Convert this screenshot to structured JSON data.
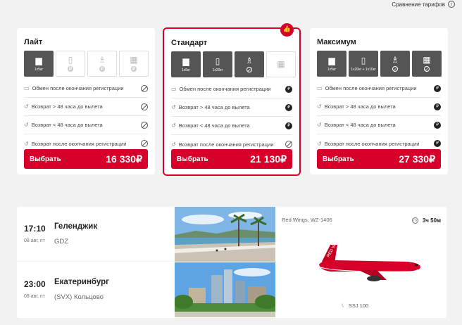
{
  "compare": {
    "label": "Сравнение тарифов"
  },
  "colors": {
    "accent": "#d7002a",
    "option_on": "#555555"
  },
  "tariffs": [
    {
      "name": "Лайт",
      "selected": false,
      "options": [
        {
          "icon": "bag-icon",
          "label": "1x5кг",
          "on": true,
          "mark": ""
        },
        {
          "icon": "luggage-icon",
          "label": "",
          "on": false,
          "mark": "₽"
        },
        {
          "icon": "seat-icon",
          "label": "",
          "on": false,
          "mark": "₽"
        },
        {
          "icon": "calendar-icon",
          "label": "",
          "on": false,
          "mark": "₽"
        }
      ],
      "rows": [
        {
          "text": "Обмен после окончания регистрации",
          "icon": "calendar-small-icon",
          "status": "no"
        },
        {
          "text": "Возврат > 48 часа до вылета",
          "icon": "return-icon",
          "status": "no"
        },
        {
          "text": "Возврат < 48 часа до вылета",
          "icon": "return-icon",
          "status": "no"
        },
        {
          "text": "Возврат после окончания регистрации",
          "icon": "return-icon",
          "status": "no"
        }
      ],
      "button": "Выбрать",
      "price": "16 330₽"
    },
    {
      "name": "Стандарт",
      "selected": true,
      "options": [
        {
          "icon": "bag-icon",
          "label": "1x5кг",
          "on": true,
          "mark": ""
        },
        {
          "icon": "luggage-icon",
          "label": "1x20кг",
          "on": true,
          "mark": ""
        },
        {
          "icon": "seat-icon",
          "label": "",
          "on": true,
          "mark": "✓"
        },
        {
          "icon": "calendar-icon",
          "label": "",
          "on": false,
          "mark": ""
        }
      ],
      "rows": [
        {
          "text": "Обмен после окончания регистрации",
          "icon": "calendar-small-icon",
          "status": "paid"
        },
        {
          "text": "Возврат > 48 часа до вылета",
          "icon": "return-icon",
          "status": "paid"
        },
        {
          "text": "Возврат < 48 часа до вылета",
          "icon": "return-icon",
          "status": "paid"
        },
        {
          "text": "Возврат после окончания регистрации",
          "icon": "return-icon",
          "status": "no"
        }
      ],
      "button": "Выбрать",
      "price": "21 130₽"
    },
    {
      "name": "Максимум",
      "selected": false,
      "options": [
        {
          "icon": "bag-icon",
          "label": "1x5кг",
          "on": true,
          "mark": ""
        },
        {
          "icon": "luggage-icon",
          "label": "1x20кг + 1x10кг",
          "on": true,
          "mark": ""
        },
        {
          "icon": "seat-icon",
          "label": "",
          "on": true,
          "mark": "✓"
        },
        {
          "icon": "calendar-icon",
          "label": "",
          "on": true,
          "mark": "✓"
        }
      ],
      "rows": [
        {
          "text": "Обмен после окончания регистрации",
          "icon": "calendar-small-icon",
          "status": "paid"
        },
        {
          "text": "Возврат > 48 часа до вылета",
          "icon": "return-icon",
          "status": "paid"
        },
        {
          "text": "Возврат < 48 часа до вылета",
          "icon": "return-icon",
          "status": "paid"
        },
        {
          "text": "Возврат после окончания регистрации",
          "icon": "return-icon",
          "status": "paid"
        }
      ],
      "button": "Выбрать",
      "price": "27 330₽"
    }
  ],
  "flight": {
    "departure": {
      "time": "17:10",
      "date": "08 авг, пт",
      "city": "Геленджик",
      "airport": "GDZ"
    },
    "arrival": {
      "time": "23:00",
      "date": "08 авг, пт",
      "city": "Екатеринбург",
      "airport": "(SVX) Кольцово"
    },
    "airline": "Red Wings, WZ-1406",
    "duration": "3ч 50м",
    "aircraft": "SSJ 100",
    "livery": "RED WINGS"
  }
}
